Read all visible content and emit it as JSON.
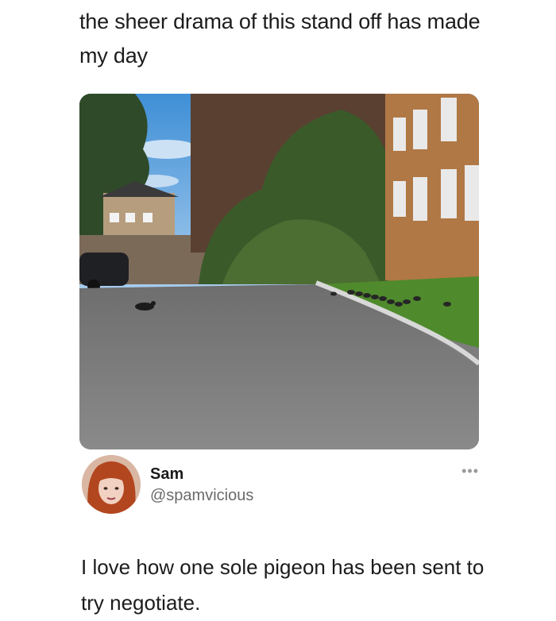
{
  "caption": {
    "text": "the sheer drama of this stand off has made my day"
  },
  "author": {
    "name": "Sam",
    "handle": "@spamvicious",
    "more_label": "•••"
  },
  "tweet": {
    "text": "I love how one sole pigeon has been sent to try negotiate."
  },
  "colors": {
    "text": "#1c1c1c",
    "handle": "#6b6b6b",
    "background": "#ffffff"
  }
}
